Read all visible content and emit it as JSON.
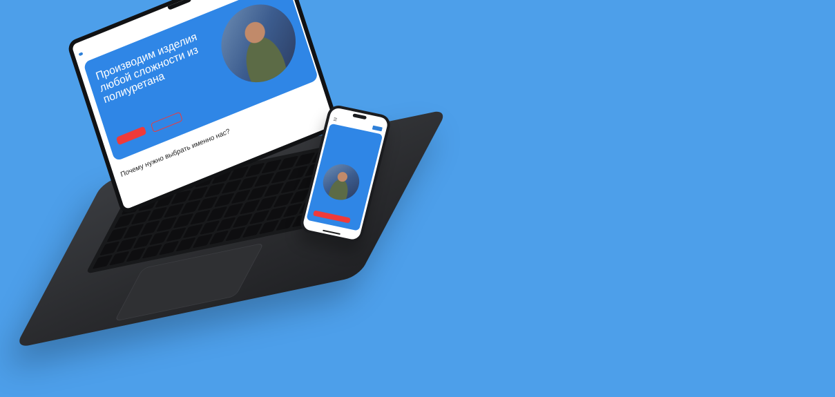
{
  "colors": {
    "background": "#4d9fea",
    "brand_blue": "#2f86e6",
    "accent_red": "#ef3a3a"
  },
  "laptop": {
    "logo": "",
    "nav": [
      {
        "label": "",
        "active": true
      },
      {
        "label": "",
        "active": false
      },
      {
        "label": "",
        "active": false
      },
      {
        "label": "",
        "active": false
      }
    ],
    "phone_number": "",
    "hero": {
      "title": "Производим изделия любой сложности из полиуретана",
      "subtitle": "",
      "primary_button": "",
      "secondary_button": ""
    },
    "section_title": "Почему нужно выбрать именно нас?"
  },
  "phone": {
    "time": "",
    "menu_icon": "hamburger-icon",
    "hero_title": "",
    "hero_subtitle": "",
    "button": ""
  }
}
